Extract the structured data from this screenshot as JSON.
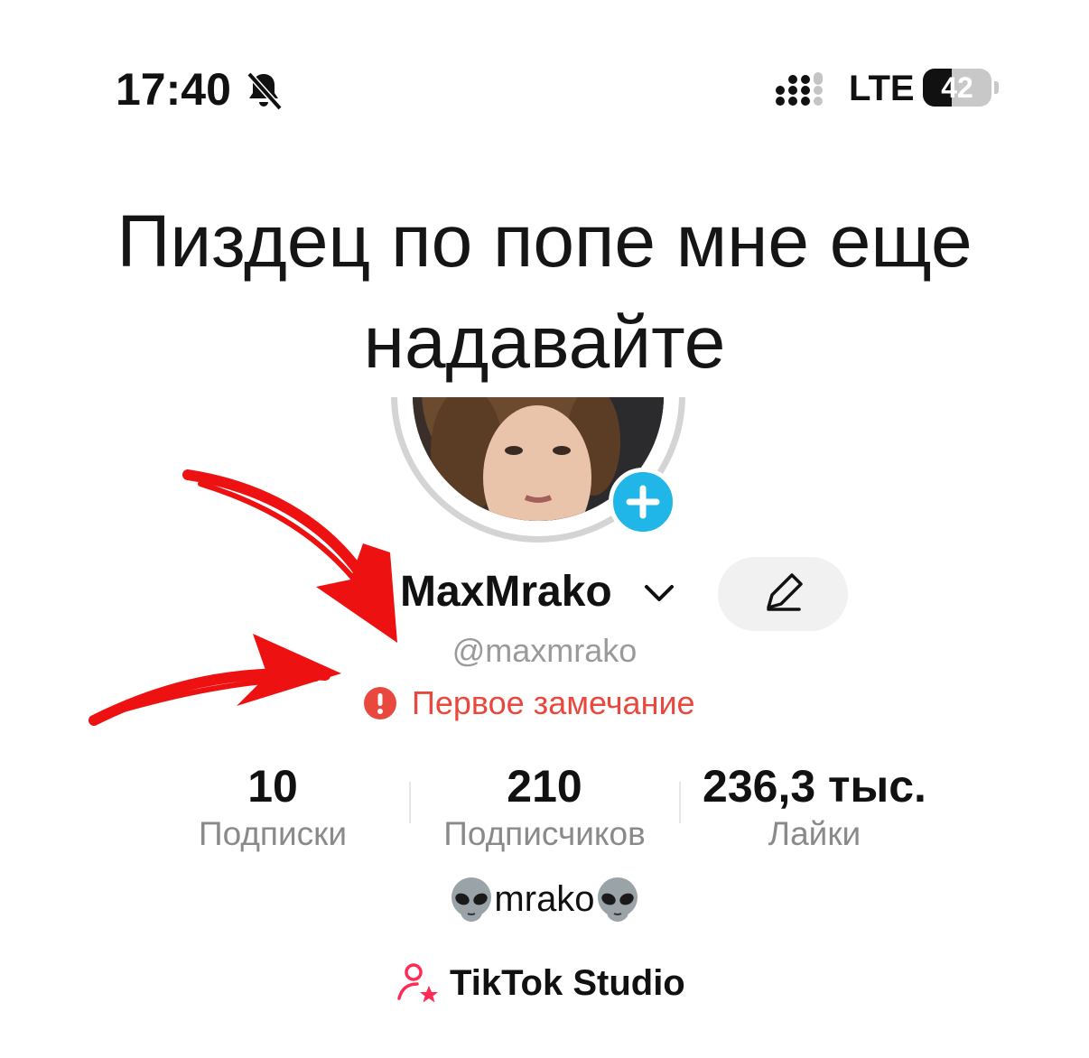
{
  "status_bar": {
    "time": "17:40",
    "network": "LTE",
    "battery": "42",
    "battery_level_percent": 42,
    "icons": [
      "bell-muted-icon",
      "signal-icon",
      "battery-icon"
    ]
  },
  "caption": {
    "line1": "Пиздец по попе мне еще",
    "line2": "надавайте"
  },
  "profile": {
    "display_name": "MaxMrako",
    "handle": "@maxmrako",
    "warning": "Первое замечание",
    "bio_text": "mrako",
    "bio_emoji": "alien-icon"
  },
  "stats": [
    {
      "value": "10",
      "label": "Подписки"
    },
    {
      "value": "210",
      "label": "Подписчиков"
    },
    {
      "value": "236,3 тыс.",
      "label": "Лайки"
    }
  ],
  "studio": {
    "label": "TikTok Studio"
  },
  "colors": {
    "warning": "#e8483e",
    "add_button": "#20b7e8",
    "studio_icon": "#fe2c55",
    "annotation_arrow": "#ee1111"
  }
}
